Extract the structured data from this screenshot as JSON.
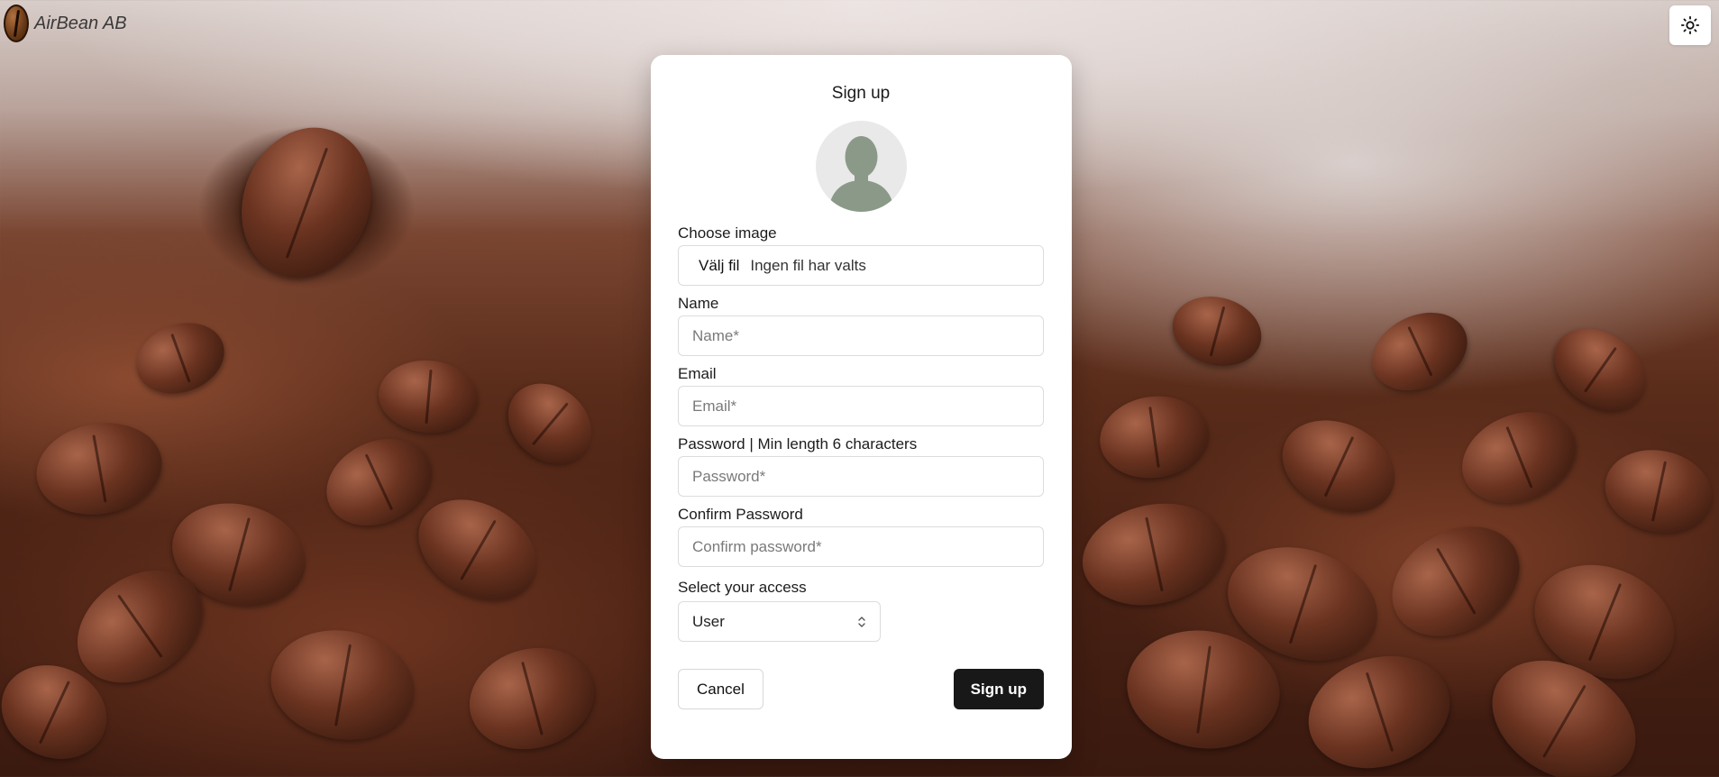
{
  "app": {
    "brand": "AirBean AB"
  },
  "header": {
    "theme_toggle_icon": "sun-icon"
  },
  "form": {
    "title": "Sign up",
    "avatar_icon": "user-silhouette-icon",
    "image": {
      "label": "Choose image",
      "button_label": "Välj fil",
      "status": "Ingen fil har valts"
    },
    "name": {
      "label": "Name",
      "placeholder": "Name*",
      "value": ""
    },
    "email": {
      "label": "Email",
      "placeholder": "Email*",
      "value": ""
    },
    "password": {
      "label": "Password | Min length 6 characters",
      "placeholder": "Password*",
      "value": ""
    },
    "confirm_password": {
      "label": "Confirm Password",
      "placeholder": "Confirm password*",
      "value": ""
    },
    "access": {
      "label": "Select your access",
      "selected": "User",
      "icon": "chevron-up-down-icon"
    },
    "cancel_label": "Cancel",
    "submit_label": "Sign up"
  },
  "colors": {
    "primary_button": "#181818",
    "card_background": "#ffffff",
    "avatar_fill": "#8b9a88"
  }
}
